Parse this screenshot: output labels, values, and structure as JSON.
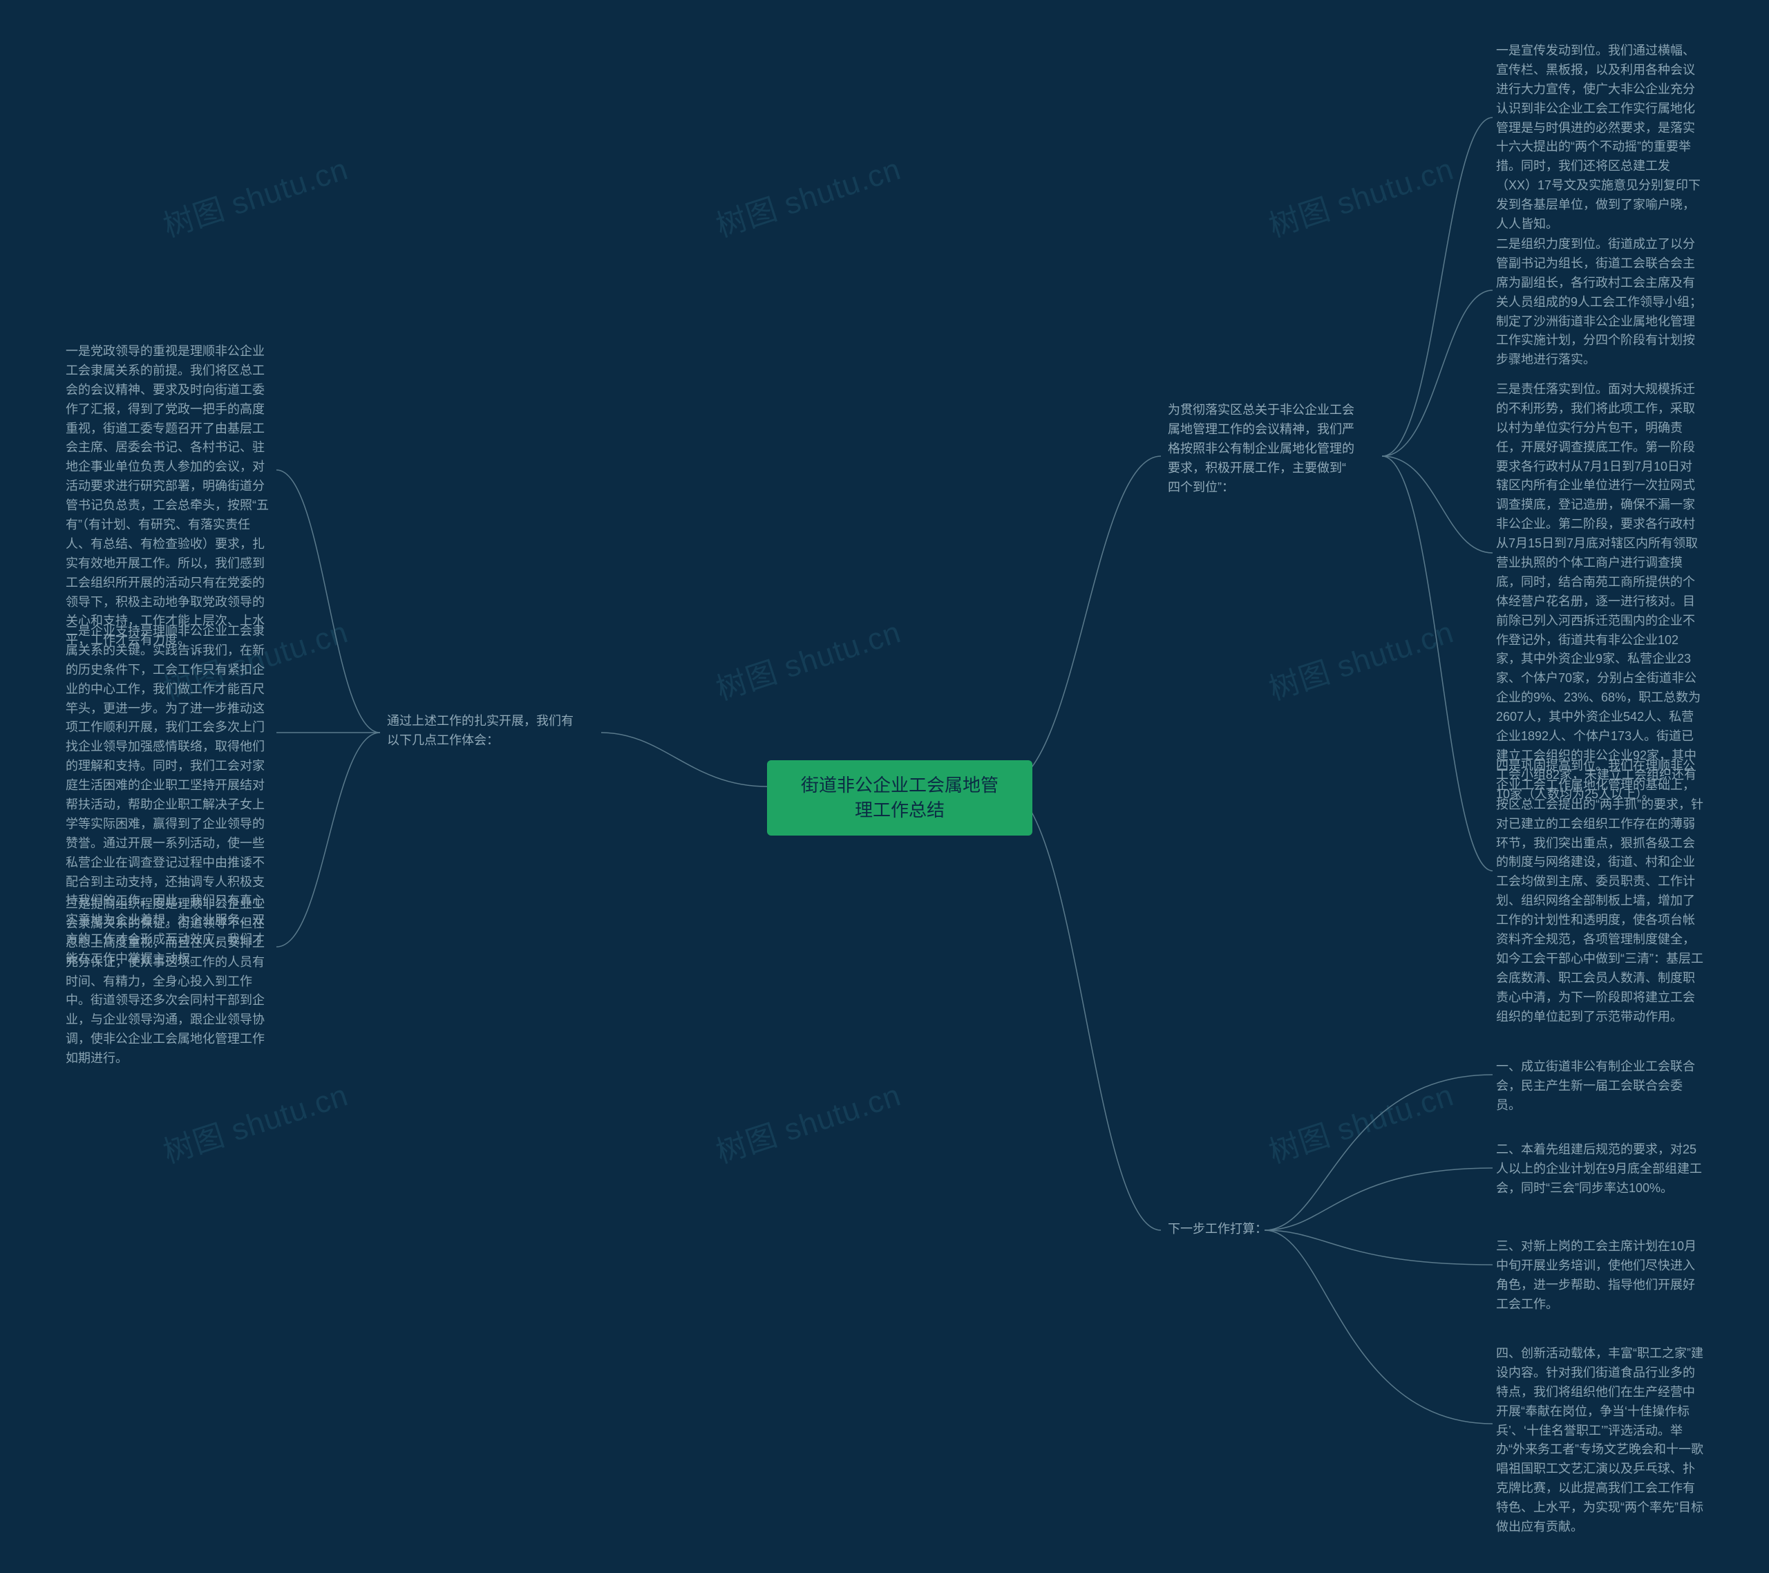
{
  "center": "街道非公企业工会属地管\n理工作总结",
  "left_branch_label": "通过上述工作的扎实开展，我们有\n以下几点工作体会：",
  "left_leaves": [
    "一是党政领导的重视是理顺非公企业工会隶属关系的前提。我们将区总工会的会议精神、要求及时向街道工委作了汇报，得到了党政一把手的高度重视，街道工委专题召开了由基层工会主席、居委会书记、各村书记、驻地企事业单位负责人参加的会议，对活动要求进行研究部署，明确街道分管书记负总责，工会总牵头，按照“五有”（有计划、有研究、有落实责任人、有总结、有检查验收）要求，扎实有效地开展工作。所以，我们感到工会组织所开展的活动只有在党委的领导下，积极主动地争取党政领导的关心和支持，工作才能上层次、上水平，工作才会有力度。",
    "二是企业支持是理顺非公企业工会隶属关系的关键。实践告诉我们，在新的历史条件下，工会工作只有紧扣企业的中心工作，我们做工作才能百尺竿头，更进一步。为了进一步推动这项工作顺利开展，我们工会多次上门找企业领导加强感情联络，取得他们的理解和支持。同时，我们工会对家庭生活困难的企业职工坚持开展结对帮扶活动，帮助企业职工解决子女上学等实际困难，赢得到了企业领导的赞誉。通过开展一系列活动，使一些私营企业在调查登记过程中由推诿不配合到主动支持，还抽调专人积极支持我们的工作。因此，我们只有真心实意地为企业着想，为企业服务，双方的工作才会形成互动效应，我们才能在工作中掌握主动权。",
    "三是提高组织程度是理顺非公企业工会隶属关系的保证。街道领导不但在思想上高度重视，而且在人员安排上充分保证，使从事这项工作的人员有时间、有精力，全身心投入到工作中。街道领导还多次会同村干部到企业，与企业领导沟通，跟企业领导协调，使非公企业工会属地化管理工作如期进行。"
  ],
  "right_branch1_label": "为贯彻落实区总关于非公企业工会\n属地管理工作的会议精神，我们严\n格按照非公有制企业属地化管理的\n要求，积极开展工作，主要做到“\n四个到位”：",
  "right_branch1_leaves": [
    "一是宣传发动到位。我们通过横幅、宣传栏、黑板报，以及利用各种会议进行大力宣传，使广大非公企业充分认识到非公企业工会工作实行属地化管理是与时俱进的必然要求，是落实十六大提出的“两个不动摇”的重要举措。同时，我们还将区总建工发（XX）17号文及实施意见分别复印下发到各基层单位，做到了家喻户晓，人人皆知。",
    "二是组织力度到位。街道成立了以分管副书记为组长，街道工会联合会主席为副组长，各行政村工会主席及有关人员组成的9人工会工作领导小组；制定了沙洲街道非公企业属地化管理工作实施计划，分四个阶段有计划按步骤地进行落实。",
    "三是责任落实到位。面对大规模拆迁的不利形势，我们将此项工作，采取以村为单位实行分片包干，明确责任，开展好调查摸底工作。第一阶段要求各行政村从7月1日到7月10日对辖区内所有企业单位进行一次拉网式调查摸底，登记造册，确保不漏一家非公企业。第二阶段，要求各行政村从7月15日到7月底对辖区内所有领取营业执照的个体工商户进行调查摸底，同时，结合南苑工商所提供的个体经营户花名册，逐一进行核对。目前除已列入河西拆迁范围内的企业不作登记外，街道共有非公企业102家，其中外资企业9家、私营企业23家、个体户70家，分别占全街道非公企业的9%、23%、68%，职工总数为2607人，其中外资企业542人、私营企业1892人、个体户173人。街道已建立工会组织的非公企业92家，其中工会小组82家，未建立工会组织还有10家（人数均为25人以上）。",
    "四是巩固提高到位。我们在理顺非公企业工会工作属地化管理的基础上，按区总工会提出的“两手抓”的要求，针对已建立的工会组织工作存在的薄弱环节，我们突出重点，狠抓各级工会的制度与网络建设，街道、村和企业工会均做到主席、委员职责、工作计划、组织网络全部制板上墙，增加了工作的计划性和透明度，使各项台帐资料齐全规范，各项管理制度健全，如今工会干部心中做到“三清”：基层工会底数清、职工会员人数清、制度职责心中清，为下一阶段即将建立工会组织的单位起到了示范带动作用。"
  ],
  "right_branch2_label": "下一步工作打算：",
  "right_branch2_leaves": [
    "一、成立街道非公有制企业工会联合会，民主产生新一届工会联合会委员。",
    "二、本着先组建后规范的要求，对25人以上的企业计划在9月底全部组建工会，同时“三会”同步率达100%。",
    "三、对新上岗的工会主席计划在10月中旬开展业务培训，使他们尽快进入角色，进一步帮助、指导他们开展好工会工作。",
    "四、创新活动载体，丰富“职工之家”建设内容。针对我们街道食品行业多的特点，我们将组织他们在生产经营中开展“奉献在岗位，争当‘十佳操作标兵’、‘十佳名誉职工’”评选活动。举办“外来务工者”专场文艺晚会和十一歌唱祖国职工文艺汇演以及乒乓球、扑克牌比赛，以此提高我们工会工作有特色、上水平，为实现“两个率先”目标做出应有贡献。"
  ],
  "watermark": "树图 shutu.cn"
}
